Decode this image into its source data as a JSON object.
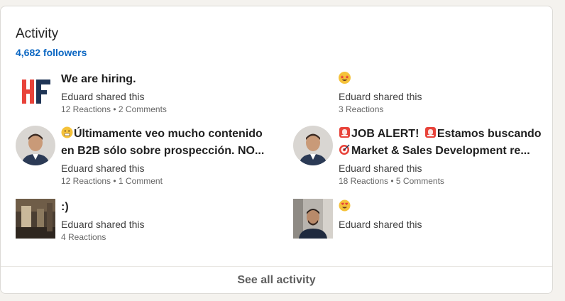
{
  "activity": {
    "title": "Activity",
    "followers": "4,682 followers",
    "see_all": "See all activity",
    "posts": [
      {
        "title": "We are hiring.",
        "shared": "Eduard shared this",
        "meta": "12 Reactions • 2 Comments",
        "thumb_icon": "hf-logo-icon"
      },
      {
        "title": "",
        "title_emoji": "star-struck-emoji-icon",
        "shared": "Eduard shared this",
        "meta": "3 Reactions"
      },
      {
        "title_emoji": "grimacing-emoji-icon",
        "title_line1": "Últimamente veo mucho contenido",
        "title_line2": "en B2B sólo sobre prospección. NO...",
        "shared": "Eduard shared this",
        "meta": "12 Reactions • 1 Comment",
        "thumb_icon": "profile-photo-icon"
      },
      {
        "title_emoji": "siren-emoji-icon",
        "title_line1": "JOB ALERT!",
        "title_line1b": "Estamos buscando",
        "title_line2": "Market & Sales Development re...",
        "title_line2_emoji": "dart-emoji-icon",
        "shared": "Eduard shared this",
        "meta": "18 Reactions • 5 Comments",
        "thumb_icon": "profile-photo-icon"
      },
      {
        "title": ":)",
        "shared": "Eduard shared this",
        "meta": "4 Reactions",
        "thumb_icon": "room-photo-icon"
      },
      {
        "title_emoji": "heart-eyes-emoji-icon",
        "shared": "Eduard shared this",
        "thumb_icon": "video-thumbnail-icon"
      }
    ]
  },
  "colors": {
    "accent": "#0a66c2",
    "hf_red": "#e8433a",
    "hf_navy": "#1f3556"
  }
}
